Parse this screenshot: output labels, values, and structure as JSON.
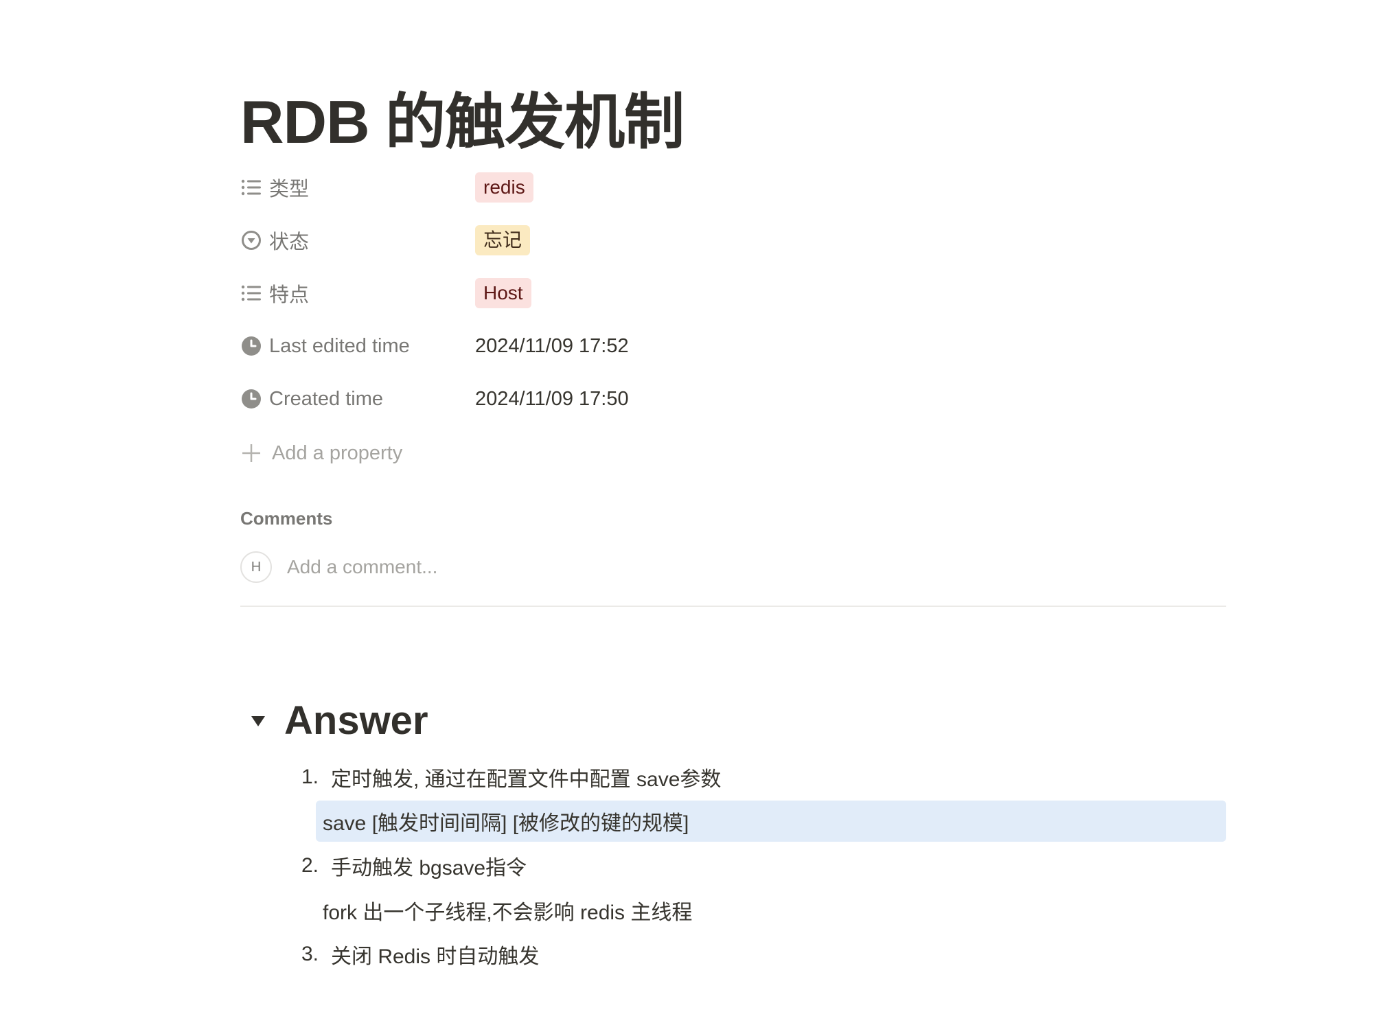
{
  "page": {
    "title": "RDB 的触发机制"
  },
  "properties": [
    {
      "name": "类型",
      "icon": "list-icon",
      "value": "redis",
      "type": "tag",
      "tag_color": "#fbe1df"
    },
    {
      "name": "状态",
      "icon": "status-icon",
      "value": "忘记",
      "type": "tag",
      "tag_color": "#fbeac1"
    },
    {
      "name": "特点",
      "icon": "list-icon",
      "value": "Host",
      "type": "tag",
      "tag_color": "#fbe1df"
    },
    {
      "name": "Last edited time",
      "icon": "clock-icon",
      "value": "2024/11/09 17:52",
      "type": "text"
    },
    {
      "name": "Created time",
      "icon": "clock-icon",
      "value": "2024/11/09 17:50",
      "type": "text"
    }
  ],
  "add_property": {
    "label": "Add a property",
    "icon": "plus-icon"
  },
  "comments": {
    "label": "Comments",
    "avatar_initial": "H",
    "placeholder": "Add a comment..."
  },
  "content": {
    "heading": "Answer",
    "items": [
      {
        "number": "1.",
        "text": "定时触发, 通过在配置文件中配置 save参数",
        "sub": "save [触发时间间隔] [被修改的键的规模]"
      },
      {
        "number": "2.",
        "text": "手动触发 bgsave指令",
        "sub": "fork 出一个子线程,不会影响 redis 主线程"
      },
      {
        "number": "3.",
        "text": "关闭 Redis 时自动触发"
      }
    ]
  },
  "colors": {
    "text": "#37352f",
    "muted": "#787774",
    "tag_red": "#fbe1df",
    "tag_yellow": "#fbeac1",
    "highlight": "#e1ecf9"
  }
}
